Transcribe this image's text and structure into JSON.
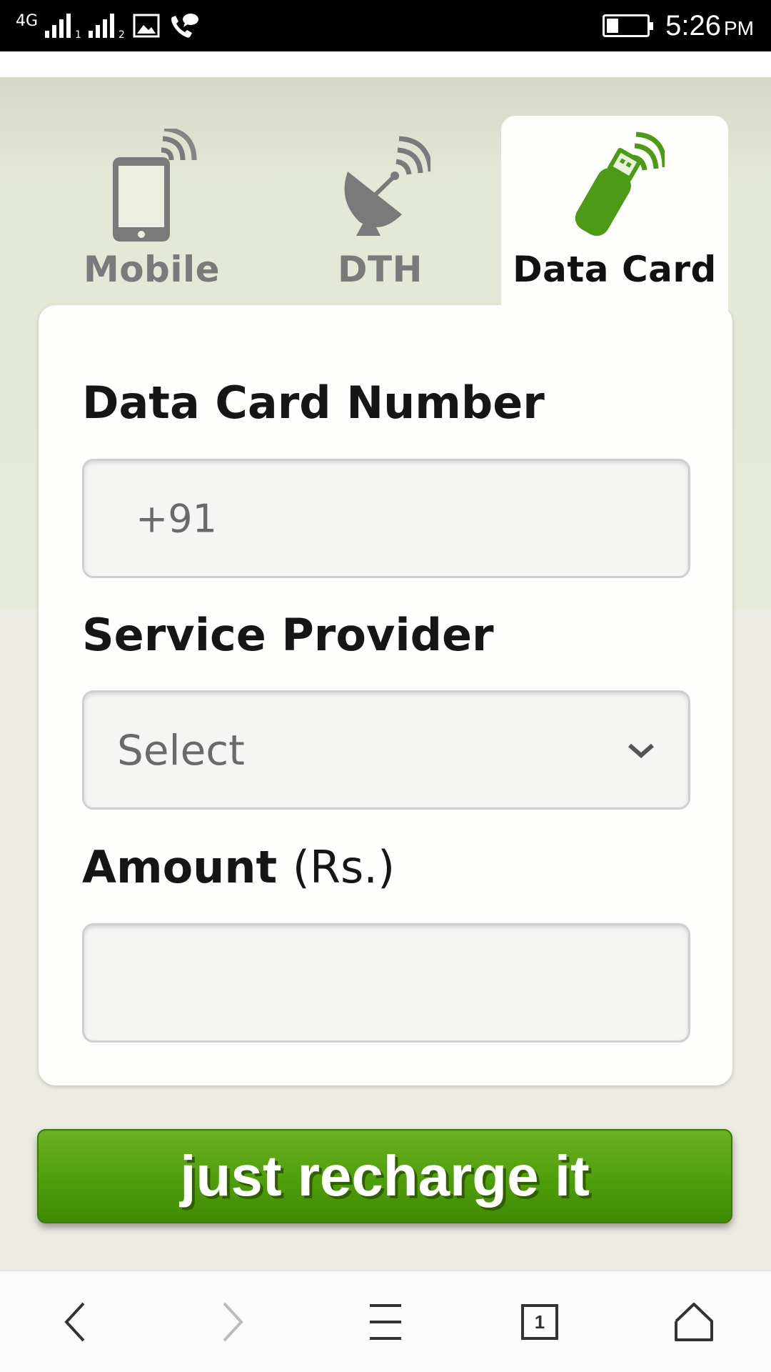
{
  "status_bar": {
    "network_type": "4G",
    "sim1_label": "1",
    "sim2_label": "2",
    "time": "5:26",
    "ampm": "PM",
    "battery_level": 0.3
  },
  "tabs": [
    {
      "label": "Mobile",
      "icon": "mobile-phone-icon",
      "selected": false
    },
    {
      "label": "DTH",
      "icon": "satellite-dish-icon",
      "selected": false
    },
    {
      "label": "Data Card",
      "icon": "usb-datacard-icon",
      "selected": true
    }
  ],
  "form": {
    "number_label": "Data Card Number",
    "number_prefix": "+91",
    "provider_label": "Service Provider",
    "provider_selected": "Select",
    "amount_label": "Amount",
    "amount_unit": "(Rs.)",
    "amount_value": ""
  },
  "submit_label": "just recharge it",
  "colors": {
    "accent_green": "#4e9e0a",
    "icon_gray": "#7a7a7a",
    "icon_green": "#4c9a16"
  },
  "bottom_nav": {
    "tab_count": "1",
    "icons": [
      "back-icon",
      "forward-icon",
      "menu-icon",
      "tabs-icon",
      "home-icon"
    ]
  }
}
